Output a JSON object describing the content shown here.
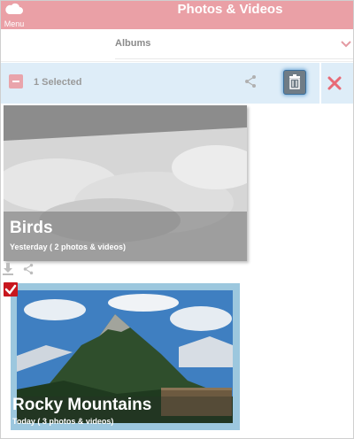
{
  "header": {
    "menu_label": "Menu",
    "title": "Photos & Videos",
    "color": "#eaa0a6"
  },
  "albums_bar": {
    "label": "Albums"
  },
  "selection_bar": {
    "selected_text": "1 Selected"
  },
  "albums": [
    {
      "name": "Birds",
      "subtitle": "Yesterday ( 2 photos & videos)",
      "selected": false
    },
    {
      "name": "Rocky Mountains",
      "subtitle": "Today ( 3 photos & videos)",
      "selected": true
    }
  ],
  "colors": {
    "accent": "#c8161e",
    "selection_bar": "#deedf8"
  }
}
